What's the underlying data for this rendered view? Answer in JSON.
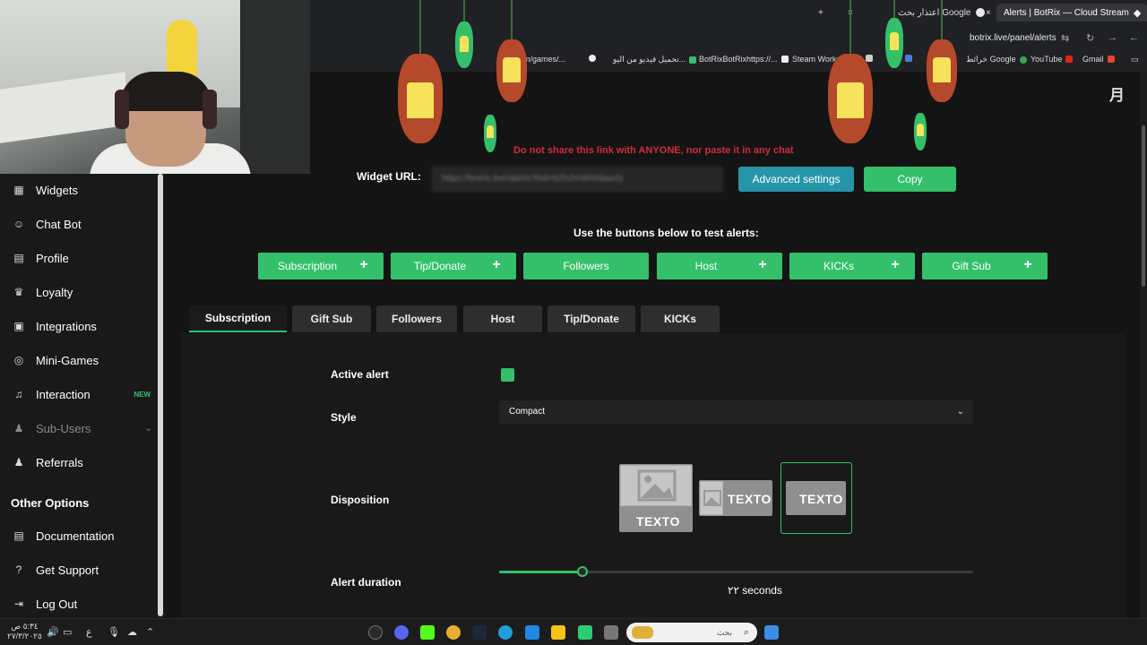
{
  "browser": {
    "tabs": [
      {
        "label": "Alerts | BotRix — Cloud Stream",
        "active": true
      },
      {
        "label": "اعتذار بحث Google",
        "active": false
      }
    ],
    "url": "botrix.live/panel/alerts",
    "bookmarks": [
      {
        "label": "Gmail"
      },
      {
        "label": "YouTube"
      },
      {
        "label": "خرائط Google"
      },
      {
        "label": "Steam Workshop"
      },
      {
        "label": "BotRixBotRixhttps://..."
      },
      {
        "label": "تحميل فيديو من اليو..."
      },
      {
        "label": "km.com/games/..."
      }
    ]
  },
  "sidebar": {
    "items": [
      {
        "label": "Widgets",
        "icon": "widgets-icon"
      },
      {
        "label": "Chat Bot",
        "icon": "robot-icon"
      },
      {
        "label": "Profile",
        "icon": "id-card-icon"
      },
      {
        "label": "Loyalty",
        "icon": "trophy-icon"
      },
      {
        "label": "Integrations",
        "icon": "puzzle-icon"
      },
      {
        "label": "Mini-Games",
        "icon": "gamepad-icon"
      },
      {
        "label": "Interaction",
        "icon": "music-note-icon",
        "badge": "NEW"
      },
      {
        "label": "Sub-Users",
        "icon": "users-icon"
      },
      {
        "label": "Referrals",
        "icon": "referral-icon"
      }
    ],
    "section_title": "Other Options",
    "other_items": [
      {
        "label": "Documentation",
        "icon": "document-icon"
      },
      {
        "label": "Get Support",
        "icon": "help-icon"
      },
      {
        "label": "Log Out",
        "icon": "logout-icon"
      }
    ]
  },
  "main": {
    "warning": "Do not share this link with ANYONE, nor paste it in any chat",
    "widget_url_label": "Widget URL:",
    "widget_url_value": "https://botrix.live/alerts?bid=bZh2mW0Idaacfy",
    "advanced_button": "Advanced settings",
    "copy_button": "Copy",
    "test_label": "Use the buttons below to test alerts:",
    "test_buttons": [
      {
        "label": "Subscription",
        "plus": true
      },
      {
        "label": "Tip/Donate",
        "plus": true
      },
      {
        "label": "Followers",
        "plus": false
      },
      {
        "label": "Host",
        "plus": true
      },
      {
        "label": "KICKs",
        "plus": true
      },
      {
        "label": "Gift Sub",
        "plus": true
      }
    ],
    "tabs": [
      {
        "label": "Subscription",
        "active": true
      },
      {
        "label": "Gift Sub",
        "active": false
      },
      {
        "label": "Followers",
        "active": false
      },
      {
        "label": "Host",
        "active": false
      },
      {
        "label": "Tip/Donate",
        "active": false
      },
      {
        "label": "KICKs",
        "active": false
      }
    ],
    "settings": {
      "active_alert_label": "Active alert",
      "active_alert_checked": true,
      "style_label": "Style",
      "style_value": "Compact",
      "disposition_label": "Disposition",
      "disposition_text": "TEXTO",
      "disposition_selected": 3,
      "duration_label": "Alert duration",
      "duration_value": "٢٢",
      "duration_unit": "seconds",
      "duration_fraction": 0.175
    }
  },
  "taskbar": {
    "time": "٥:٣٤ ص",
    "date": "٢٧/٣/٢٠٢٥",
    "search_placeholder": "بحث",
    "lang": "ع"
  },
  "colors": {
    "accent_green": "#34c06a",
    "accent_teal": "#2795a8",
    "warning_red": "#d12b3c",
    "background": "#141414"
  }
}
